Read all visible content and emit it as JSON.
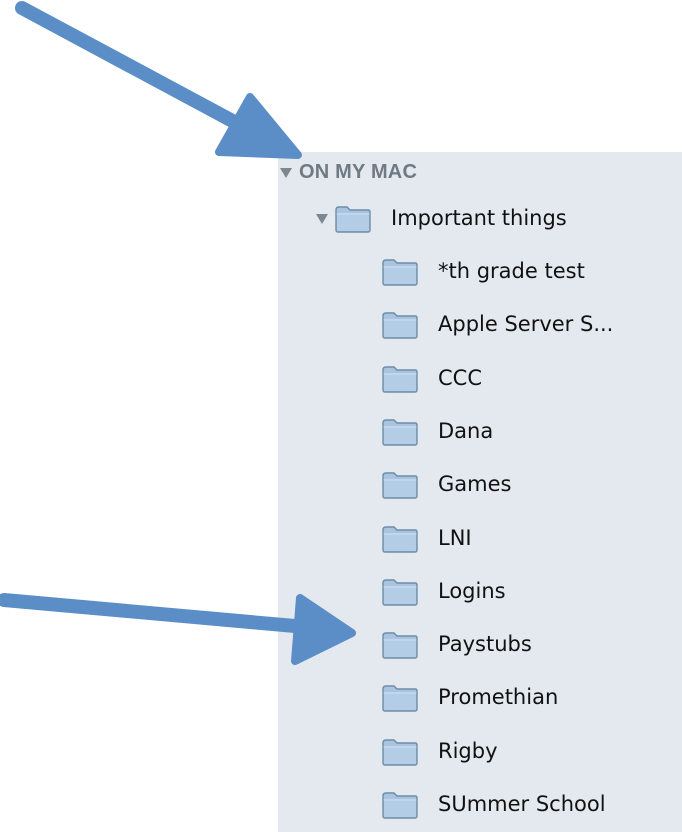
{
  "sidebar": {
    "section_title": "ON MY MAC",
    "parent_folder": {
      "label": "Important things",
      "icon": "folder-icon",
      "expanded": true
    },
    "folders": [
      {
        "label": "*th grade test",
        "icon": "folder-icon"
      },
      {
        "label": "Apple Server S...",
        "icon": "folder-icon"
      },
      {
        "label": "CCC",
        "icon": "folder-icon"
      },
      {
        "label": "Dana",
        "icon": "folder-icon"
      },
      {
        "label": "Games",
        "icon": "folder-icon"
      },
      {
        "label": "LNI",
        "icon": "folder-icon"
      },
      {
        "label": "Logins",
        "icon": "folder-icon"
      },
      {
        "label": "Paystubs",
        "icon": "folder-icon"
      },
      {
        "label": "Promethian",
        "icon": "folder-icon"
      },
      {
        "label": "Rigby",
        "icon": "folder-icon"
      },
      {
        "label": "SUmmer School",
        "icon": "folder-icon"
      }
    ]
  },
  "annotations": {
    "arrow_color": "#5b8dc7",
    "arrows": [
      {
        "name": "arrow-to-section-header",
        "points_at": "ON MY MAC"
      },
      {
        "name": "arrow-to-paystubs",
        "points_at": "Paystubs"
      }
    ]
  },
  "colors": {
    "sidebar_background": "#e4e9ef",
    "folder_fill": "#a9c4e0",
    "folder_stroke": "#6f8ca8"
  }
}
